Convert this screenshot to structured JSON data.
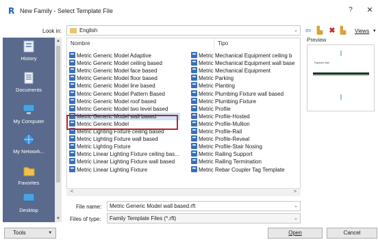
{
  "window": {
    "title": "New Family - Select Template File",
    "app_icon_letter": "R",
    "help_label": "?",
    "close_label": "✕"
  },
  "lookin": {
    "label": "Look in:",
    "value": "English"
  },
  "toolbar": {
    "views_label": "Views"
  },
  "places": [
    {
      "label": "History",
      "icon": "history-icon"
    },
    {
      "label": "Documents",
      "icon": "documents-icon"
    },
    {
      "label": "My Computer",
      "icon": "computer-icon"
    },
    {
      "label": "My Network...",
      "icon": "network-icon"
    },
    {
      "label": "Favorites",
      "icon": "favorites-icon"
    },
    {
      "label": "Desktop",
      "icon": "desktop-icon"
    }
  ],
  "file_list": {
    "headers": {
      "name": "Nombre",
      "type": "Tipo"
    },
    "left_column": [
      "Metric Generic Model Adaptive",
      "Metric Generic Model ceiling based",
      "Metric Generic Model face based",
      "Metric Generic Model floor based",
      "Metric Generic Model line based",
      "Metric Generic Model Pattern Based",
      "Metric Generic Model roof based",
      "Metric Generic Model two level based",
      "Metric Generic Model wall based",
      "Metric Generic Model",
      "Metric Lighting Fixture ceiling based",
      "Metric Lighting Fixture wall based",
      "Metric Lighting Fixture",
      "Metric Linear Lighting Fixture ceiling bas...",
      "Metric Linear Lighting Fixture wall based",
      "Metric Linear Lighting Fixture"
    ],
    "right_column": [
      "Metric Mechanical Equipment ceiling b",
      "Metric Mechanical Equipment wall base",
      "Metric Mechanical Equipment",
      "Metric Parking",
      "Metric Planting",
      "Metric Plumbing Fixture wall based",
      "Metric Plumbing Fixture",
      "Metric Profile",
      "Metric Profile-Hosted",
      "Metric Profile-Mullion",
      "Metric Profile-Rail",
      "Metric Profile-Reveal",
      "Metric Profile-Stair Nosing",
      "Metric Railing Support",
      "Metric Railing Termination",
      "Metric Rebar Coupler Tag Template"
    ],
    "selected_index": 8
  },
  "preview": {
    "label": "Preview",
    "note": "Papamet Sale"
  },
  "file_name": {
    "label": "File name:",
    "value": "Metric Generic Model wall based.rft"
  },
  "file_type": {
    "label": "Files of type:",
    "value": "Family Template Files  (*.rft)"
  },
  "buttons": {
    "tools": "Tools",
    "open": "Open",
    "cancel": "Cancel"
  },
  "colors": {
    "places_bg": "#5a6a8c",
    "selection": "#cde3f7",
    "highlight_border": "#b3222a",
    "file_icon": "#3a6fb5"
  }
}
